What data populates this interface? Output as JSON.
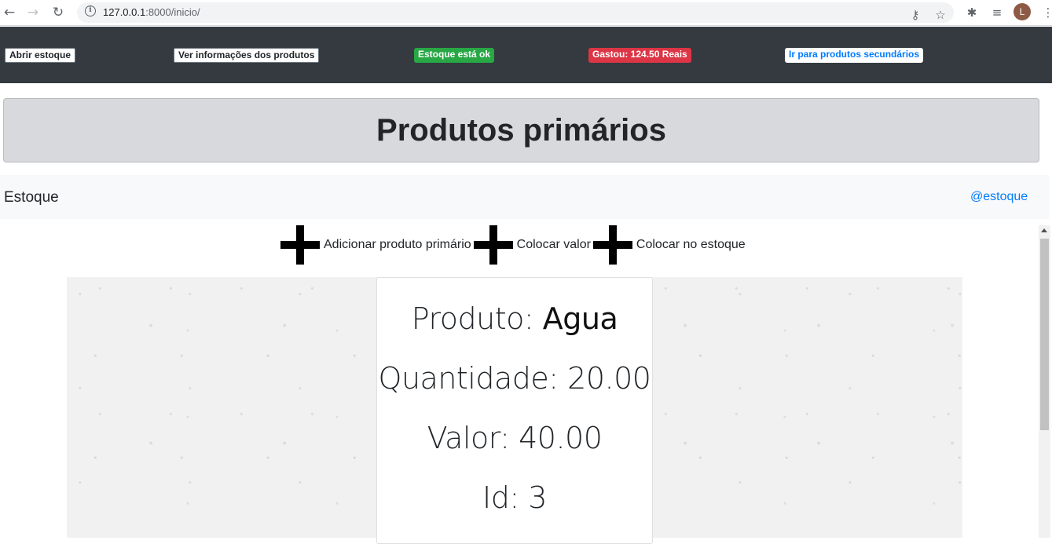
{
  "browser": {
    "url_host": "127.0.0.1",
    "url_rest": ":8000/inicio/",
    "avatar_letter": "L"
  },
  "navbar": {
    "open_stock": "Abrir estoque",
    "view_info": "Ver informações dos produtos",
    "stock_status": "Estoque está ok",
    "spent": "Gastou: 124.50 Reais",
    "secondary_link": "Ir para produtos secundários"
  },
  "header": {
    "title": "Produtos primários"
  },
  "subnav": {
    "brand": "Estoque",
    "link": "@estoque"
  },
  "actions": [
    {
      "label": "Adicionar produto primário"
    },
    {
      "label": "Colocar valor"
    },
    {
      "label": "Colocar no estoque"
    }
  ],
  "product": {
    "name_label": "Produto: ",
    "name": "Agua",
    "quantity": "Quantidade: 20.00",
    "value": "Valor: 40.00",
    "id": "Id: 3"
  },
  "colors": {
    "navbar_bg": "#343a40",
    "status_ok": "#28a745",
    "status_spent": "#dc3545",
    "link": "#007bff"
  }
}
